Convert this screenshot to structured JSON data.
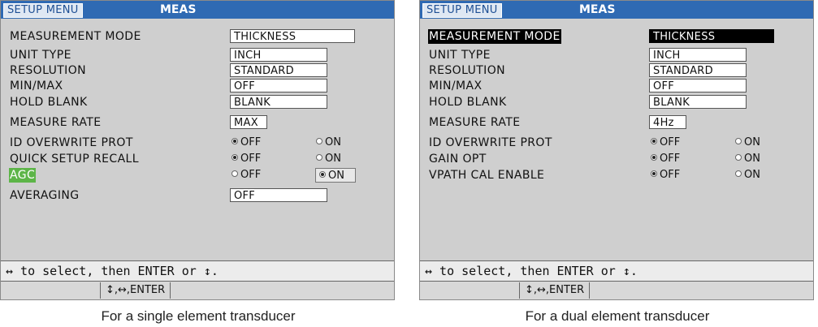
{
  "panels": [
    {
      "title_setup": "SETUP MENU",
      "title_meas": "MEAS",
      "rows": [
        {
          "label": "MEASUREMENT MODE",
          "value": "THICKNESS"
        },
        {
          "label": "UNIT TYPE",
          "value": "INCH"
        },
        {
          "label": "RESOLUTION",
          "value": "STANDARD"
        },
        {
          "label": "MIN/MAX",
          "value": "OFF"
        },
        {
          "label": "HOLD BLANK",
          "value": "BLANK"
        },
        {
          "label": "MEASURE RATE",
          "value": "MAX"
        },
        {
          "label": "ID OVERWRITE PROT",
          "off": "OFF",
          "on": "ON",
          "selected": "OFF"
        },
        {
          "label": "QUICK SETUP RECALL",
          "off": "OFF",
          "on": "ON",
          "selected": "OFF"
        },
        {
          "label": "AGC",
          "off": "OFF",
          "on": "ON",
          "selected": "ON"
        },
        {
          "label": "AVERAGING",
          "value": "OFF"
        }
      ],
      "help": "↔ to select, then ENTER or ↕.",
      "keys": "↕,↔,ENTER",
      "caption": "For a single element transducer"
    },
    {
      "title_setup": "SETUP MENU",
      "title_meas": "MEAS",
      "rows": [
        {
          "label": "MEASUREMENT MODE",
          "value": "THICKNESS"
        },
        {
          "label": "UNIT TYPE",
          "value": "INCH"
        },
        {
          "label": "RESOLUTION",
          "value": "STANDARD"
        },
        {
          "label": "MIN/MAX",
          "value": "OFF"
        },
        {
          "label": "HOLD BLANK",
          "value": "BLANK"
        },
        {
          "label": "MEASURE RATE",
          "value": "4Hz"
        },
        {
          "label": "ID OVERWRITE PROT",
          "off": "OFF",
          "on": "ON",
          "selected": "OFF"
        },
        {
          "label": "GAIN OPT",
          "off": "OFF",
          "on": "ON",
          "selected": "OFF"
        },
        {
          "label": "VPATH CAL ENABLE",
          "off": "OFF",
          "on": "ON",
          "selected": "OFF"
        }
      ],
      "help": "↔ to select, then ENTER or ↕.",
      "keys": "↕,↔,ENTER",
      "caption": "For a dual element transducer"
    }
  ],
  "colors": {
    "title_bar": "#2f6ab3",
    "highlight_green": "#5db548",
    "highlight_black": "#000000"
  }
}
